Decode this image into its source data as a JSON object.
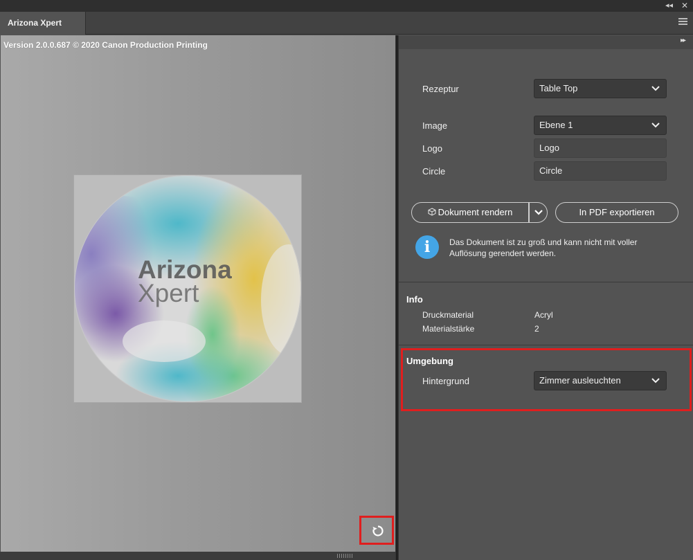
{
  "window": {
    "collapse_glyph": "◂◂",
    "close_glyph": "✕"
  },
  "tab": {
    "title": "Arizona Xpert"
  },
  "preview": {
    "version": "Version 2.0.0.687 © 2020 Canon Production Printing",
    "logo_line1": "Arizona",
    "logo_line2": "Xpert"
  },
  "panel": {
    "expand_glyph": "▸▸",
    "rezeptur": {
      "label": "Rezeptur",
      "value": "Table Top"
    },
    "image": {
      "label": "Image",
      "value": "Ebene 1"
    },
    "logo": {
      "label": "Logo",
      "value": "Logo"
    },
    "circle": {
      "label": "Circle",
      "value": "Circle"
    },
    "render_button": "Dokument rendern",
    "pdf_button": "In PDF exportieren",
    "info_message": "Das Dokument ist zu groß und kann nicht mit voller Auflösung gerendert werden.",
    "info_section": {
      "title": "Info",
      "druckmaterial_label": "Druckmaterial",
      "druckmaterial_value": "Acryl",
      "staerke_label": "Materialstärke",
      "staerke_value": "2"
    },
    "umgebung": {
      "title": "Umgebung",
      "hintergrund_label": "Hintergrund",
      "hintergrund_value": "Zimmer ausleuchten"
    }
  },
  "colors": {
    "highlight": "#e01e1e",
    "info_blue": "#44a5e6"
  }
}
